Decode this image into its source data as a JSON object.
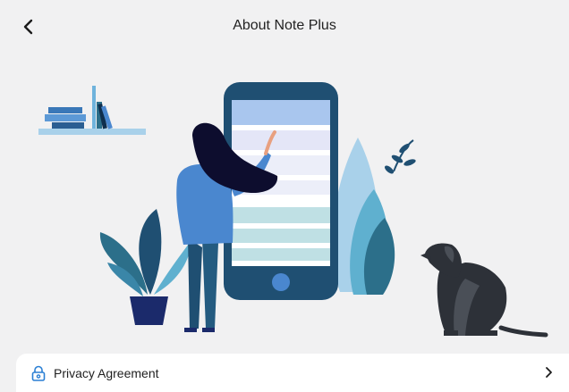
{
  "header": {
    "title": "About Note Plus",
    "back_icon": "chevron-left-icon"
  },
  "illustration": {
    "subject": "person-using-phone-illustration"
  },
  "settings_list": {
    "items": [
      {
        "label": "Privacy Agreement",
        "icon": "lock-icon",
        "trailing_icon": "chevron-right-icon"
      }
    ]
  },
  "colors": {
    "background": "#f1f1f2",
    "phone_frame": "#1f4f72",
    "screen_accent": "#a9c6ee",
    "teal": "#2c6f8a",
    "light_teal": "#5fb0cf",
    "hair": "#0d0d2e",
    "sweater": "#4a87cf",
    "icon_blue": "#2a7fd4"
  }
}
